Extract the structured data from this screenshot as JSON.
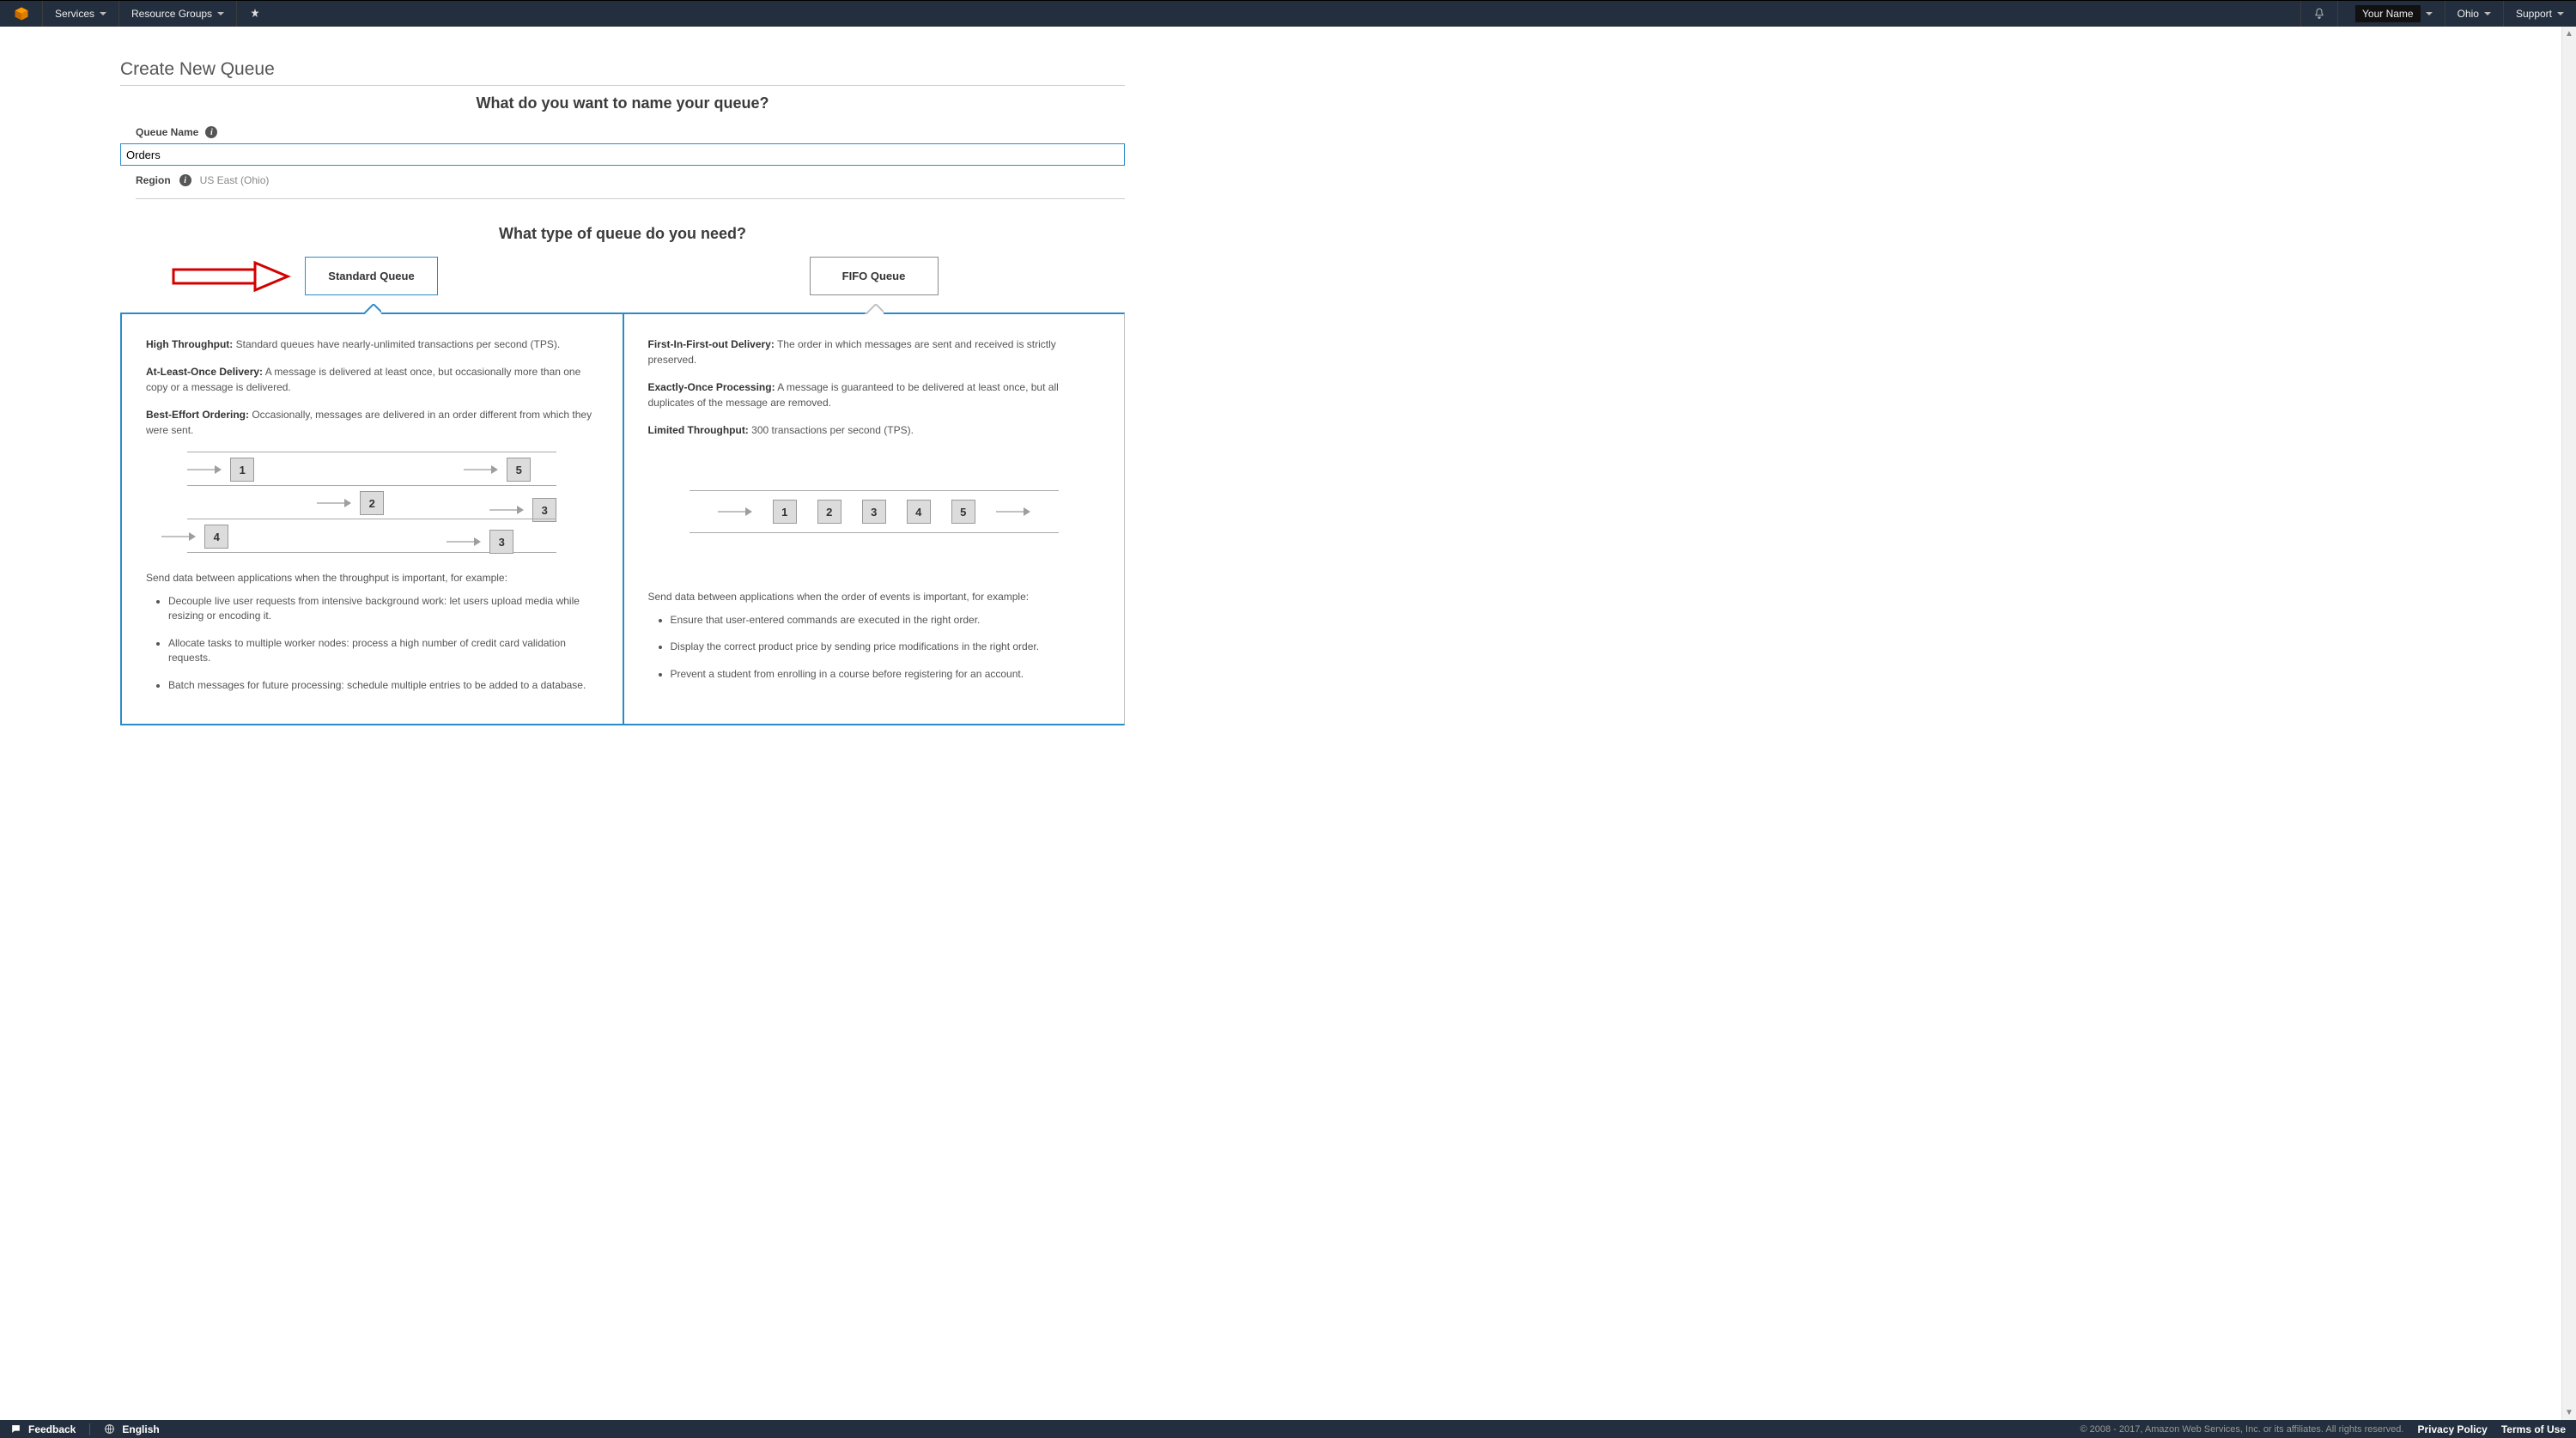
{
  "topbar": {
    "services": "Services",
    "resource_groups": "Resource Groups",
    "your_name": "Your Name",
    "region": "Ohio",
    "support": "Support"
  },
  "page": {
    "title": "Create New Queue",
    "name_question": "What do you want to name your queue?",
    "queue_name_label": "Queue Name",
    "queue_name_value": "Orders",
    "region_label": "Region",
    "region_value": "US East (Ohio)",
    "type_question": "What type of queue do you need?"
  },
  "standard": {
    "button": "Standard Queue",
    "points": [
      {
        "b": "High Throughput:",
        "t": " Standard queues have nearly-unlimited transactions per second (TPS)."
      },
      {
        "b": "At-Least-Once Delivery:",
        "t": " A message is delivered at least once, but occasionally more than one copy or a message is delivered."
      },
      {
        "b": "Best-Effort Ordering:",
        "t": " Occasionally, messages are delivered in an order different from which they were sent."
      }
    ],
    "usage": "Send data between applications when the throughput is important, for example:",
    "bullets": [
      "Decouple live user requests from intensive background work: let users upload media while resizing or encoding it.",
      "Allocate tasks to multiple worker nodes: process a high number of credit card validation requests.",
      "Batch messages for future processing: schedule multiple entries to be added to a database."
    ],
    "diagram_order": [
      [
        "1",
        "5"
      ],
      [
        "2",
        "3"
      ],
      [
        "4",
        "3"
      ]
    ]
  },
  "fifo": {
    "button": "FIFO Queue",
    "points": [
      {
        "b": "First-In-First-out Delivery:",
        "t": " The order in which messages are sent and received is strictly preserved."
      },
      {
        "b": "Exactly-Once Processing:",
        "t": " A message is guaranteed to be delivered at least once, but all duplicates of the message are removed."
      },
      {
        "b": "Limited Throughput:",
        "t": " 300 transactions per second (TPS)."
      }
    ],
    "usage": "Send data between applications when the order of events is important, for example:",
    "bullets": [
      "Ensure that user-entered commands are executed in the right order.",
      "Display the correct product price by sending price modifications in the right order.",
      "Prevent a student from enrolling in a course before registering for an account."
    ],
    "diagram_order": [
      "1",
      "2",
      "3",
      "4",
      "5"
    ]
  },
  "footer": {
    "feedback": "Feedback",
    "english": "English",
    "copyright": "© 2008 - 2017, Amazon Web Services, Inc. or its affiliates. All rights reserved.",
    "privacy": "Privacy Policy",
    "terms": "Terms of Use"
  }
}
